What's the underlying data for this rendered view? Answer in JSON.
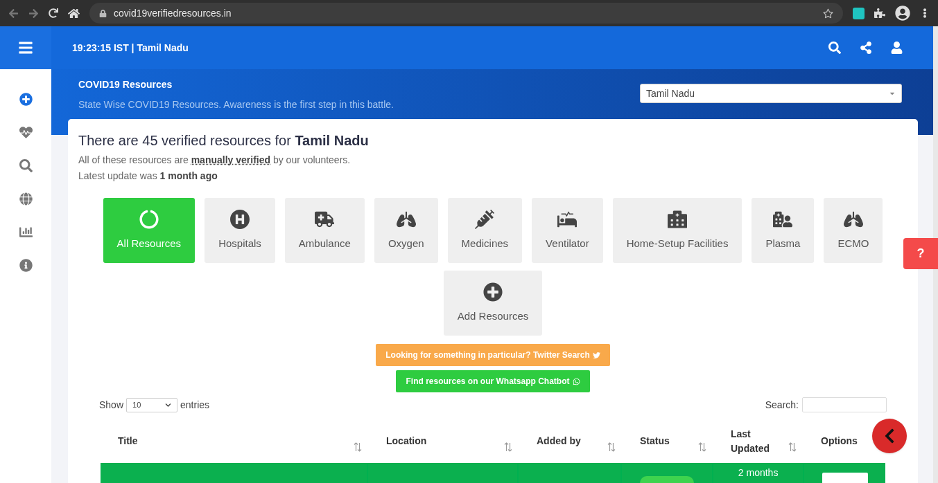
{
  "browser": {
    "url": "covid19verifiedresources.in"
  },
  "header": {
    "title": "19:23:15 IST | Tamil Nadu"
  },
  "banner": {
    "title": "COVID19 Resources",
    "subtitle": "State Wise COVID19 Resources. Awareness is the first step in this battle.",
    "state_select": "Tamil Nadu"
  },
  "summary": {
    "heading": "There are 45 verified resources for **Tamil Nadu**",
    "line_1": "All of these resources are **manually verified** by our volunteers.",
    "line_2": "Latest update was **1 month ago**"
  },
  "categories": [
    {
      "label": "All Resources",
      "selected": true
    },
    {
      "label": "Hospitals",
      "selected": false
    },
    {
      "label": "Ambulance",
      "selected": false
    },
    {
      "label": "Oxygen",
      "selected": false
    },
    {
      "label": "Medicines",
      "selected": false
    },
    {
      "label": "Ventilator",
      "selected": false
    },
    {
      "label": "Home-Setup Facilities",
      "selected": false
    },
    {
      "label": "Plasma",
      "selected": false
    },
    {
      "label": "ECMO",
      "selected": false
    },
    {
      "label": "Add Resources",
      "selected": false
    }
  ],
  "twitter_button": "Looking for something in particular? Twitter Search",
  "whatsapp_button": "Find resources on our Whatsapp Chatbot",
  "table_controls": {
    "show_label": "Show",
    "page_size": "10",
    "entries_label": "entries",
    "search_label": "Search:"
  },
  "table": {
    "columns": [
      "Title",
      "Location",
      "Added by",
      "Status",
      "Last Updated",
      "Options"
    ],
    "rows": [
      {
        "last_updated": "2 months"
      }
    ]
  },
  "help_tab": "?"
}
